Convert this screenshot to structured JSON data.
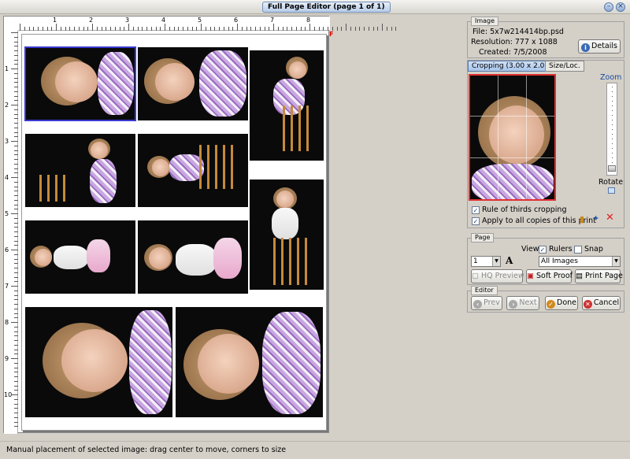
{
  "window": {
    "title": "Full Page Editor (page 1 of 1)"
  },
  "rulers": {
    "top": [
      "1",
      "2",
      "3",
      "4",
      "5",
      "6",
      "7",
      "8"
    ],
    "left": [
      "1",
      "2",
      "3",
      "4",
      "5",
      "6",
      "7",
      "8",
      "9",
      "10"
    ]
  },
  "image_panel": {
    "tab": "Image",
    "file": "File: 5x7w214414bp.psd",
    "resolution": "Resolution: 777 x 1088",
    "created": "Created: 7/5/2008",
    "details_button": "Details"
  },
  "crop_panel": {
    "tabs": [
      "Cropping (3.00 x 2.00)",
      "Size/Loc."
    ],
    "zoom_label": "Zoom",
    "rotate_label": "Rotate",
    "rule_of_thirds": "Rule of thirds cropping",
    "apply_all": "Apply to all copies of this print"
  },
  "page_panel": {
    "tab": "Page",
    "view_label": "View:",
    "rulers_label": "Rulers",
    "snap_label": "Snap",
    "page_select": "1",
    "font_glyph": "A",
    "images_select": "All Images",
    "hq_preview": "HQ Preview",
    "soft_proof": "Soft Proof",
    "print_page": "Print Page"
  },
  "editor_panel": {
    "tab": "Editor",
    "prev": "Prev",
    "next": "Next",
    "done": "Done",
    "cancel": "Cancel"
  },
  "status": {
    "text": "Manual placement of selected image: drag center to move, corners to size"
  },
  "colors": {
    "accent_blue": "#5a7aa8",
    "crop_border": "#e03030",
    "photo_bg": "#0a0a0a"
  }
}
